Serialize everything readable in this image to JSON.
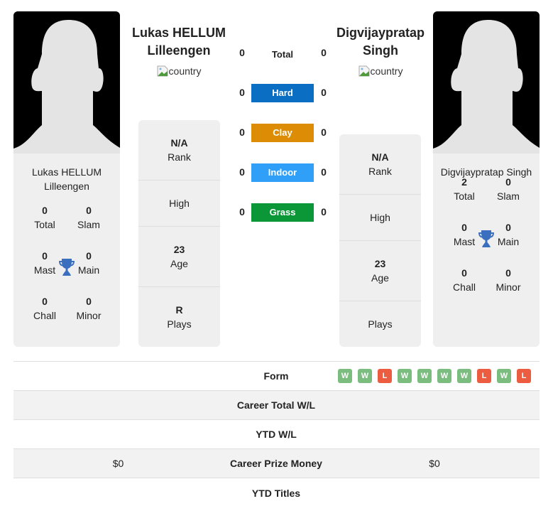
{
  "players": [
    {
      "name": "Lukas HELLUM Lilleengen",
      "name_line1": "Lukas HELLUM",
      "name_line2": "Lilleengen",
      "country_alt": "country",
      "card_name_line1": "Lukas HELLUM",
      "card_name_line2": "Lilleengen",
      "titles": {
        "total": {
          "value": "0",
          "label": "Total"
        },
        "slam": {
          "value": "0",
          "label": "Slam"
        },
        "mast": {
          "value": "0",
          "label": "Mast"
        },
        "main": {
          "value": "0",
          "label": "Main"
        },
        "chall": {
          "value": "0",
          "label": "Chall"
        },
        "minor": {
          "value": "0",
          "label": "Minor"
        }
      },
      "info": {
        "rank": {
          "value": "N/A",
          "label": "Rank"
        },
        "high": {
          "value": "",
          "label": "High"
        },
        "age": {
          "value": "23",
          "label": "Age"
        },
        "plays": {
          "value": "R",
          "label": "Plays"
        }
      }
    },
    {
      "name": "Digvijaypratap Singh",
      "name_line1": "Digvijaypratap",
      "name_line2": "Singh",
      "country_alt": "country",
      "card_name_line1": "Digvijaypratap Singh",
      "card_name_line2": "",
      "titles": {
        "total": {
          "value": "2",
          "label": "Total"
        },
        "slam": {
          "value": "0",
          "label": "Slam"
        },
        "mast": {
          "value": "0",
          "label": "Mast"
        },
        "main": {
          "value": "0",
          "label": "Main"
        },
        "chall": {
          "value": "0",
          "label": "Chall"
        },
        "minor": {
          "value": "0",
          "label": "Minor"
        }
      },
      "info": {
        "rank": {
          "value": "N/A",
          "label": "Rank"
        },
        "high": {
          "value": "",
          "label": "High"
        },
        "age": {
          "value": "23",
          "label": "Age"
        },
        "plays": {
          "value": "",
          "label": "Plays"
        }
      }
    }
  ],
  "surfaces": [
    {
      "label": "Total",
      "left": "0",
      "right": "0",
      "color": ""
    },
    {
      "label": "Hard",
      "left": "0",
      "right": "0",
      "color": "#0a6ec2"
    },
    {
      "label": "Clay",
      "left": "0",
      "right": "0",
      "color": "#dd8c06"
    },
    {
      "label": "Indoor",
      "left": "0",
      "right": "0",
      "color": "#2f9ff8"
    },
    {
      "label": "Grass",
      "left": "0",
      "right": "0",
      "color": "#0b9637"
    }
  ],
  "comparison": {
    "form": {
      "label": "Form",
      "left": "",
      "right_results": [
        "W",
        "W",
        "L",
        "W",
        "W",
        "W",
        "W",
        "L",
        "W",
        "L"
      ]
    },
    "rows": [
      {
        "label": "Career Total W/L",
        "left": "",
        "right": ""
      },
      {
        "label": "YTD W/L",
        "left": "",
        "right": ""
      },
      {
        "label": "Career Prize Money",
        "left": "$0",
        "right": "$0"
      },
      {
        "label": "YTD Titles",
        "left": "",
        "right": ""
      }
    ]
  },
  "colors": {
    "win": "#7bbd7f",
    "loss": "#ec5c40",
    "trophy": "#3a6fc0"
  }
}
